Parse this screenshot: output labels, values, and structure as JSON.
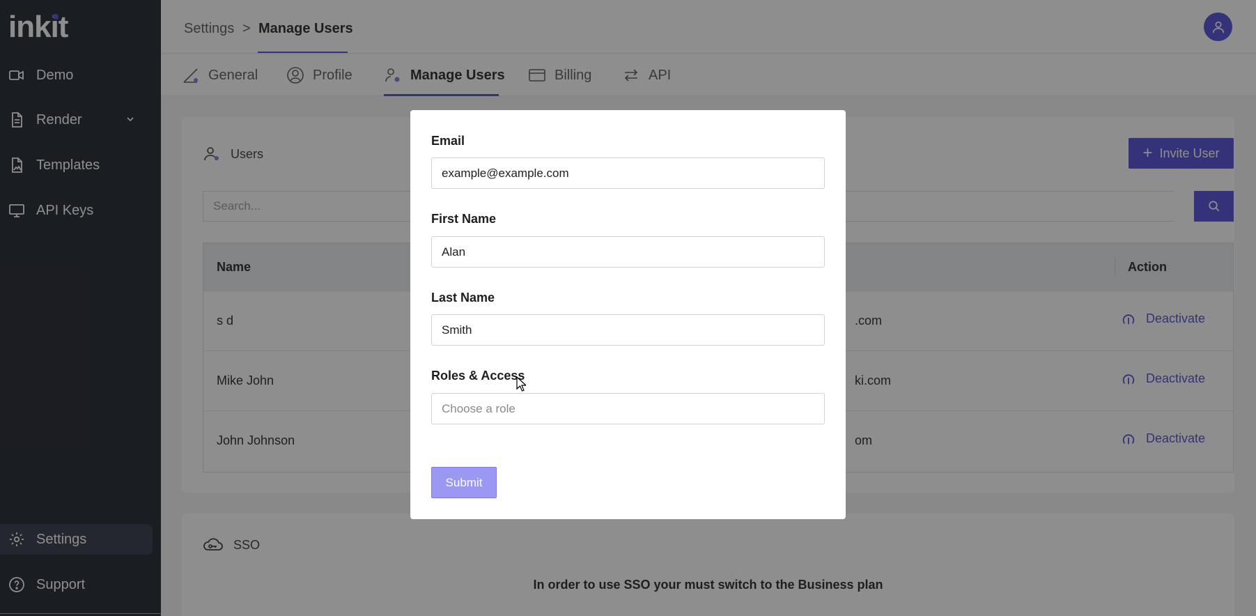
{
  "brand": {
    "logo_text": "inkit"
  },
  "sidebar": {
    "items": [
      {
        "label": "Demo",
        "icon": "video-icon"
      },
      {
        "label": "Render",
        "icon": "document-icon",
        "has_chevron": true
      },
      {
        "label": "Templates",
        "icon": "image-file-icon"
      },
      {
        "label": "API Keys",
        "icon": "monitor-icon"
      }
    ],
    "bottom_items": [
      {
        "label": "Settings",
        "icon": "gear-icon",
        "active": true
      },
      {
        "label": "Support",
        "icon": "help-circle-icon"
      }
    ]
  },
  "breadcrumb": {
    "parent": "Settings",
    "separator": ">",
    "current": "Manage Users"
  },
  "tabs": [
    {
      "label": "General",
      "icon": "pencil-ruler-icon"
    },
    {
      "label": "Profile",
      "icon": "user-circle-icon"
    },
    {
      "label": "Manage Users",
      "icon": "users-gear-icon",
      "active": true
    },
    {
      "label": "Billing",
      "icon": "credit-card-icon"
    },
    {
      "label": "API",
      "icon": "arrows-swap-icon"
    }
  ],
  "users_card": {
    "title": "Users",
    "invite_button": "Invite User",
    "search_placeholder": "Search...",
    "columns": {
      "name": "Name",
      "action": "Action"
    },
    "rows": [
      {
        "name": "s d",
        "email_partial": ".com",
        "action": "Deactivate"
      },
      {
        "name": "Mike John",
        "email_partial": "ki.com",
        "action": "Deactivate"
      },
      {
        "name": "John Johnson",
        "email_partial": "om",
        "action": "Deactivate"
      }
    ]
  },
  "sso_card": {
    "title": "SSO",
    "message": "In order to use SSO your must switch to the Business plan"
  },
  "modal": {
    "email_label": "Email",
    "email_value": "example@example.com",
    "first_name_label": "First Name",
    "first_name_value": "Alan",
    "last_name_label": "Last Name",
    "last_name_value": "Smith",
    "roles_label": "Roles & Access",
    "roles_placeholder": "Choose a role",
    "submit_label": "Submit"
  },
  "colors": {
    "accent": "#4b48d6",
    "sidebar_bg": "#171c27",
    "submit_disabled": "#9b98f3"
  }
}
